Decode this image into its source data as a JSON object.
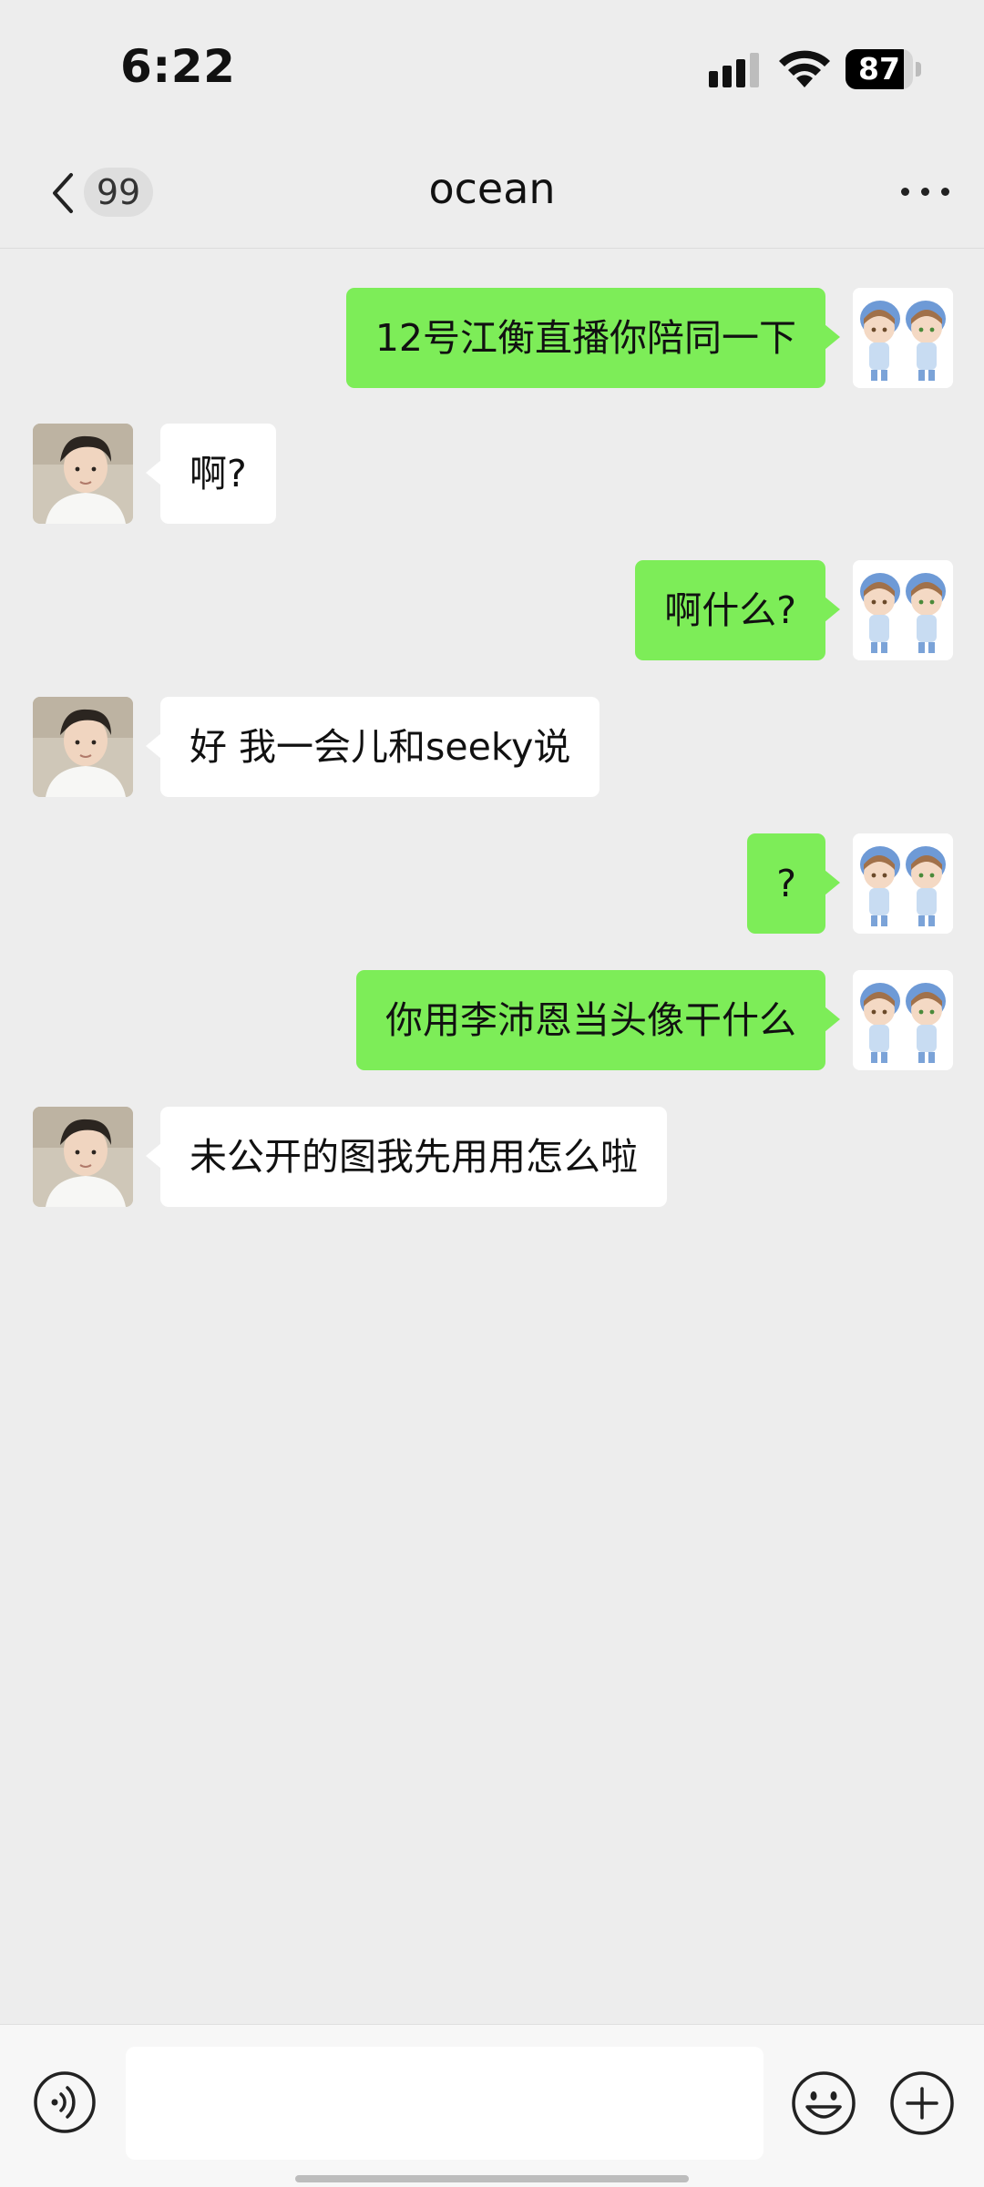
{
  "status_bar": {
    "time": "6:22",
    "battery_level": "87"
  },
  "nav": {
    "back_badge": "99",
    "title": "ocean"
  },
  "messages": [
    {
      "side": "self",
      "text": "12号江衡直播你陪同一下"
    },
    {
      "side": "other",
      "text": "啊?"
    },
    {
      "side": "self",
      "text": "啊什么?"
    },
    {
      "side": "other",
      "text": "好 我一会儿和seeky说"
    },
    {
      "side": "self",
      "text": "?"
    },
    {
      "side": "self",
      "text": "你用李沛恩当头像干什么"
    },
    {
      "side": "other",
      "text": "未公开的图我先用用怎么啦"
    }
  ],
  "input": {
    "value": "",
    "placeholder": ""
  },
  "colors": {
    "background": "#ededed",
    "self_bubble": "#7ded58",
    "other_bubble": "#ffffff",
    "input_bar": "#f7f7f7"
  },
  "icons": {
    "back": "chevron-left-icon",
    "more": "more-dots-icon",
    "voice": "voice-icon",
    "emoji": "emoji-icon",
    "plus": "plus-icon"
  }
}
